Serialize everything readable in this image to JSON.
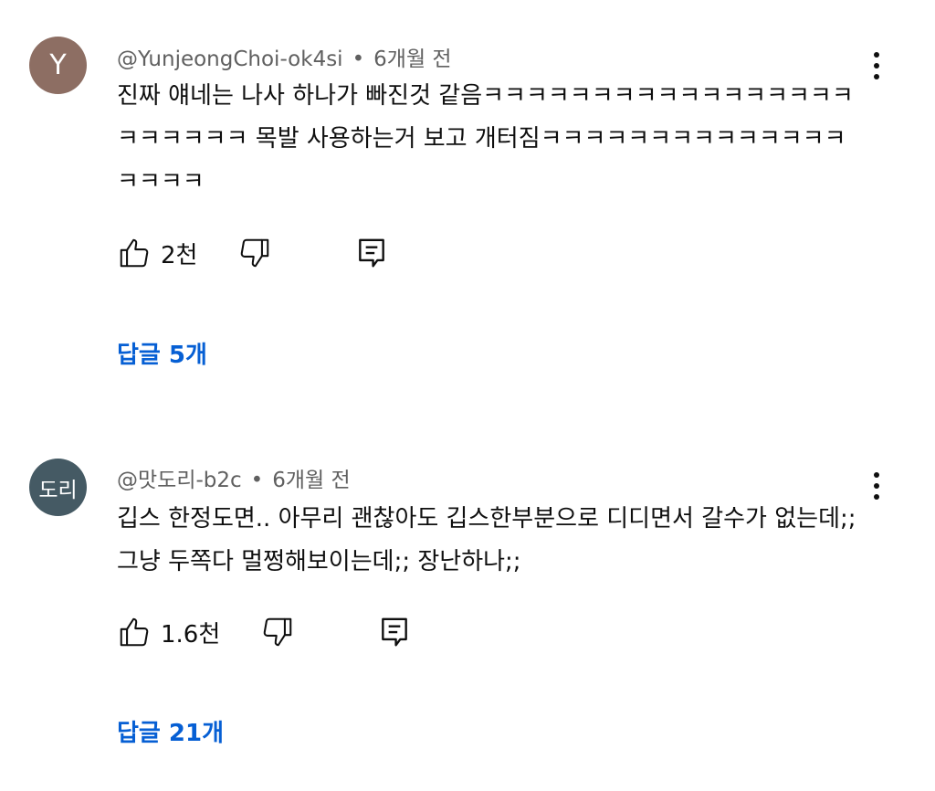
{
  "comments": [
    {
      "avatar_text": "Y",
      "avatar_color": "#8d6e63",
      "author": "@YunjeongChoi-ok4si",
      "separator": "•",
      "time": "6개월 전",
      "text": "진짜 얘네는 나사 하나가 빠진것 같음ㅋㅋㅋㅋㅋㅋㅋㅋㅋㅋㅋㅋㅋㅋㅋㅋㅋㅋㅋㅋㅋㅋㅋ 목발 사용하는거 보고 개터짐ㅋㅋㅋㅋㅋㅋㅋㅋㅋㅋㅋㅋㅋㅋㅋㅋㅋㅋ",
      "likes": "2천",
      "replies": "답글 5개"
    },
    {
      "avatar_text": "도리",
      "avatar_color": "#455a64",
      "author": "@맛도리-b2c",
      "separator": "•",
      "time": "6개월 전",
      "text": "깁스 한정도면.. 아무리 괜찮아도 깁스한부분으로 디디면서 갈수가 없는데;; 그냥 두쪽다 멀쩡해보이는데;; 장난하나;;",
      "likes": "1.6천",
      "replies": "답글 21개"
    }
  ],
  "icons": {
    "like": "thumbs-up-icon",
    "dislike": "thumbs-down-icon",
    "reply": "reply-comment-icon",
    "more": "more-vert-icon"
  },
  "colors": {
    "link": "#065fd4",
    "meta": "#606060"
  }
}
